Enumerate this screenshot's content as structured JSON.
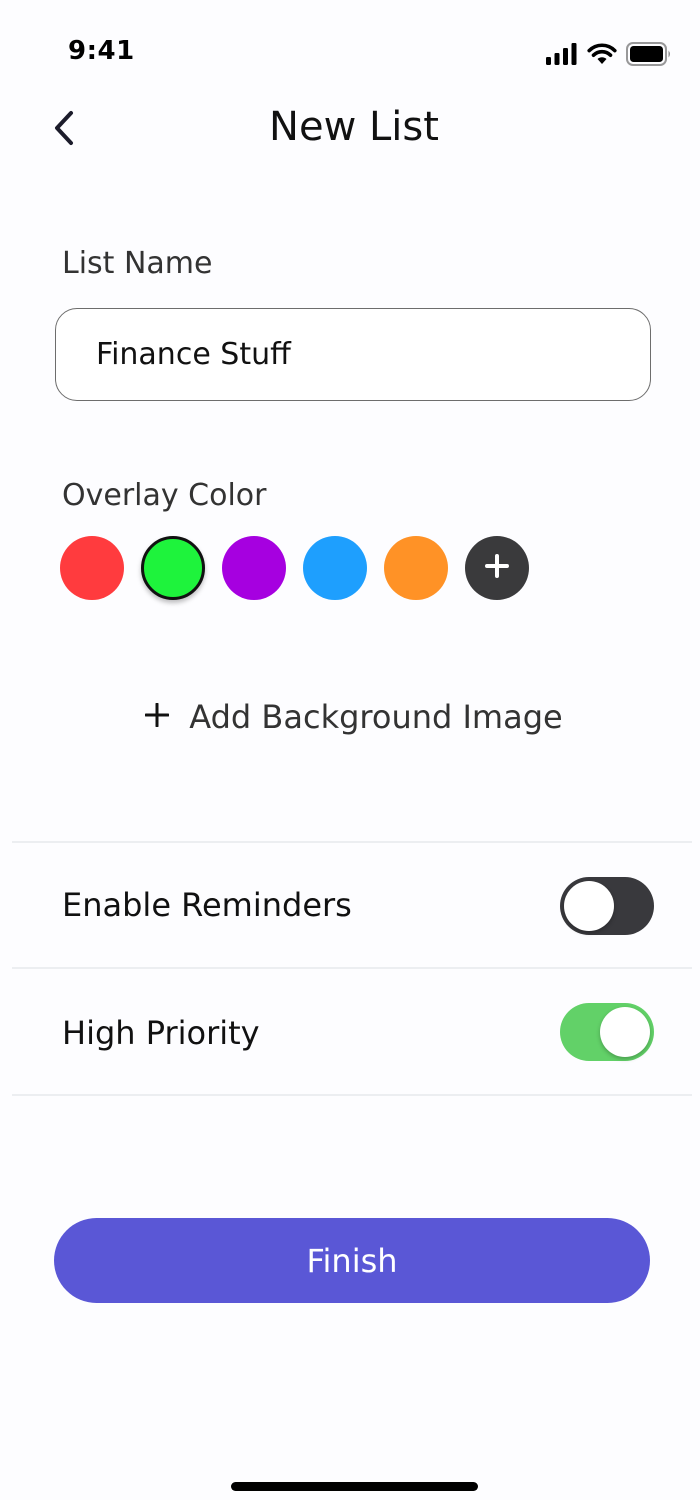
{
  "status_bar": {
    "time": "9:41",
    "icons": [
      "cellular-signal-icon",
      "wifi-icon",
      "battery-icon"
    ]
  },
  "header": {
    "title": "New List",
    "back_icon": "chevron-left-icon"
  },
  "list_name": {
    "label": "List Name",
    "value": "Finance Stuff"
  },
  "overlay_color": {
    "label": "Overlay Color",
    "swatches": [
      {
        "color": "#ff3b3e",
        "selected": false
      },
      {
        "color": "#1ef33c",
        "selected": true
      },
      {
        "color": "#a600e0",
        "selected": false
      },
      {
        "color": "#1e9ffe",
        "selected": false
      },
      {
        "color": "#ff9226",
        "selected": false
      }
    ],
    "add_color_icon": "plus-icon",
    "add_color_bg": "#3a3a3c"
  },
  "add_background": {
    "label": "Add Background Image",
    "icon": "plus-icon"
  },
  "settings": {
    "reminders": {
      "label": "Enable Reminders",
      "enabled": false,
      "track_color": "#39393d"
    },
    "priority": {
      "label": "High Priority",
      "enabled": true,
      "track_color": "#62d168"
    }
  },
  "finish": {
    "label": "Finish",
    "color": "#5a57d6"
  }
}
